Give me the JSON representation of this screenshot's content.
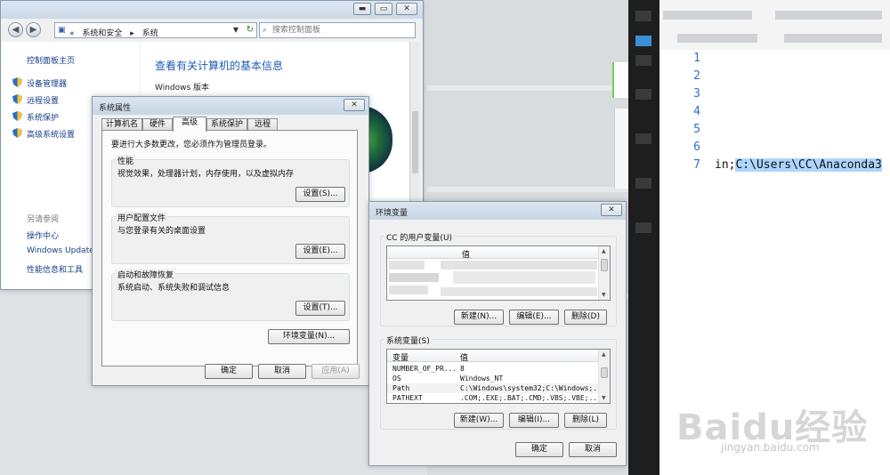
{
  "control_panel": {
    "breadcrumb_sep": "«",
    "breadcrumb_1": "系统和安全",
    "breadcrumb_arrow": "▸",
    "breadcrumb_2": "系统",
    "search_placeholder": "搜索控制面板",
    "sidebar_home": "控制面板主页",
    "sidebar_links": [
      "设备管理器",
      "远程设置",
      "系统保护",
      "高级系统设置"
    ],
    "see_also_label": "另请参阅",
    "see_also_links": [
      "操作中心",
      "Windows Update",
      "性能信息和工具"
    ],
    "main_heading": "查看有关计算机的基本信息",
    "main_sub": "Windows 版本"
  },
  "sys_props": {
    "title": "系统属性",
    "tabs": [
      "计算机名",
      "硬件",
      "高级",
      "系统保护",
      "远程"
    ],
    "admin_note": "要进行大多数更改，您必须作为管理员登录。",
    "groups": [
      {
        "legend": "性能",
        "desc": "视觉效果，处理器计划，内存使用，以及虚拟内存",
        "button": "设置(S)..."
      },
      {
        "legend": "用户配置文件",
        "desc": "与您登录有关的桌面设置",
        "button": "设置(E)..."
      },
      {
        "legend": "启动和故障恢复",
        "desc": "系统启动、系统失败和调试信息",
        "button": "设置(T)..."
      }
    ],
    "env_button": "环境变量(N)...",
    "ok": "确定",
    "cancel": "取消",
    "apply": "应用(A)"
  },
  "env_vars": {
    "title": "环境变量",
    "user_vars_label": "CC 的用户变量(U)",
    "user_value_header": "值",
    "user_new": "新建(N)...",
    "user_edit": "编辑(E)...",
    "user_delete": "删除(D)",
    "sys_vars_label": "系统变量(S)",
    "col_var": "变量",
    "col_value": "值",
    "sys_rows": [
      {
        "name": "NUMBER_OF_PR...",
        "value": "8"
      },
      {
        "name": "OS",
        "value": "Windows_NT"
      },
      {
        "name": "Path",
        "value": "C:\\Windows\\system32;C:\\Windows;..."
      },
      {
        "name": "PATHEXT",
        "value": ".COM;.EXE;.BAT;.CMD;.VBS;.VBE;..."
      }
    ],
    "sys_new": "新建(W)...",
    "sys_edit": "编辑(I)...",
    "sys_delete": "删除(L)",
    "ok": "确定",
    "cancel": "取消"
  },
  "editor": {
    "line_numbers": [
      "1",
      "2",
      "3",
      "4",
      "5",
      "6",
      "7"
    ],
    "line7_prefix": "in;",
    "line7_selected": "C:\\Users\\CC\\Anaconda3"
  },
  "watermark": {
    "brand": "Baidu经验",
    "url": "jingyan.baidu.com"
  }
}
